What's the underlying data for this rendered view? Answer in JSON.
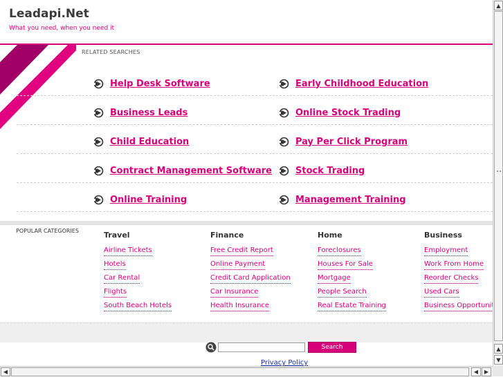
{
  "header": {
    "site_title": "Leadapi.Net",
    "tagline": "What you need, when you need it"
  },
  "related": {
    "title": "RELATED SEARCHES",
    "left": [
      "Help Desk Software",
      "Business Leads",
      "Child Education",
      "Contract Management Software",
      "Online Training"
    ],
    "right": [
      "Early Childhood Education",
      "Online Stock Trading",
      "Pay Per Click Program",
      "Stock Trading",
      "Management Training"
    ]
  },
  "popular": {
    "title": "POPULAR CATEGORIES",
    "columns": [
      {
        "heading": "Travel",
        "links": [
          "Airline Tickets",
          "Hotels",
          "Car Rental",
          "Flights",
          "South Beach Hotels"
        ]
      },
      {
        "heading": "Finance",
        "links": [
          "Free Credit Report",
          "Online Payment",
          "Credit Card Application",
          "Car Insurance",
          "Health Insurance"
        ]
      },
      {
        "heading": "Home",
        "links": [
          "Foreclosures",
          "Houses For Sale",
          "Mortgage",
          "People Search",
          "Real Estate Training"
        ]
      },
      {
        "heading": "Business",
        "links": [
          "Employment",
          "Work From Home",
          "Reorder Checks",
          "Used Cars",
          "Business Opportunities"
        ]
      }
    ]
  },
  "search": {
    "button_label": "Search",
    "input_value": "",
    "icon": "magnifier-icon"
  },
  "footer": {
    "privacy_label": "Privacy Policy"
  },
  "colors": {
    "accent": "#d6007a",
    "link_blue": "#1a30a6"
  }
}
